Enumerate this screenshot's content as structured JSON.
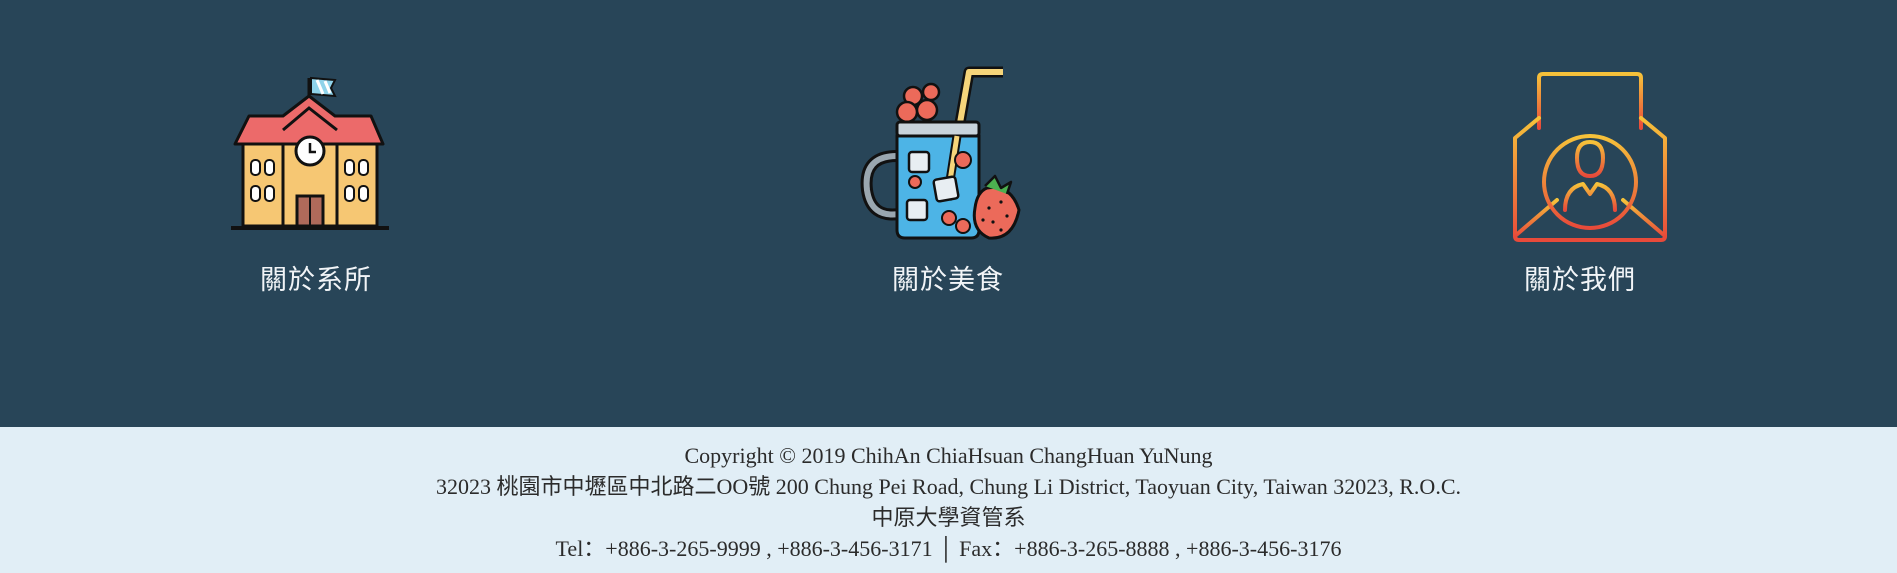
{
  "tiles": [
    {
      "label": "關於系所",
      "icon": "school-icon"
    },
    {
      "label": "關於美食",
      "icon": "drink-jar-icon"
    },
    {
      "label": "關於我們",
      "icon": "contact-letter-icon"
    }
  ],
  "footer": {
    "copyright": "Copyright © 2019 ChihAn ChiaHsuan ChangHuan YuNung",
    "address": "32023 桃園市中壢區中北路二OO號 200 Chung Pei Road, Chung Li District, Taoyuan City, Taiwan 32023, R.O.C.",
    "department": "中原大學資管系",
    "phones": "Tel：+886-3-265-9999 , +886-3-456-3171 │ Fax：+886-3-265-8888 , +886-3-456-3176"
  },
  "colors": {
    "header_bg": "#284558",
    "footer_bg": "#e1eef6",
    "tile_label": "#f1f4f7",
    "footer_text": "#2b2b2b"
  }
}
